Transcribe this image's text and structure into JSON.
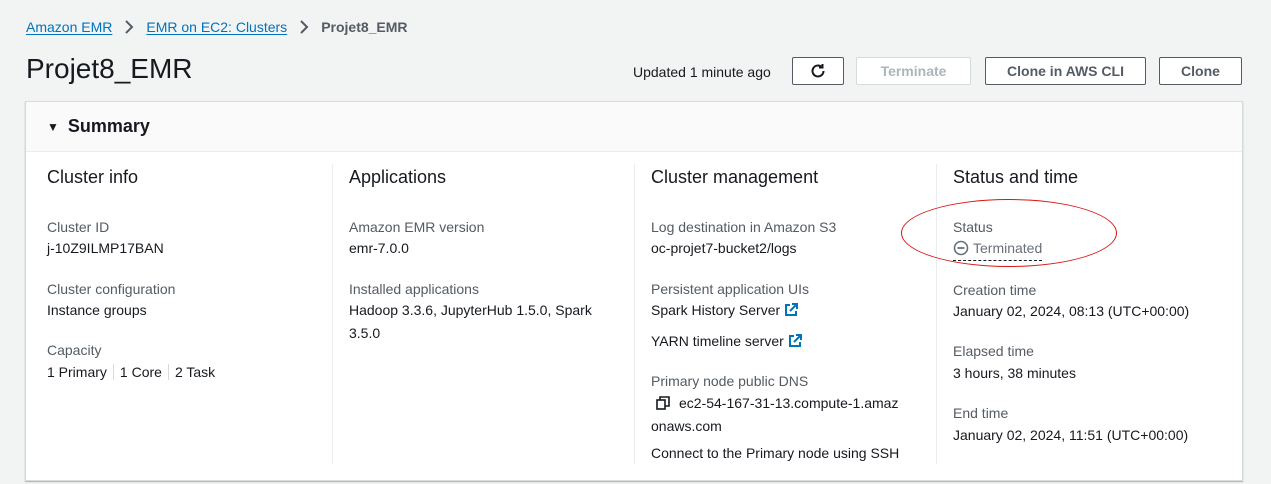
{
  "breadcrumb": {
    "items": [
      "Amazon EMR",
      "EMR on EC2: Clusters"
    ],
    "current": "Projet8_EMR"
  },
  "header": {
    "title": "Projet8_EMR",
    "updated": "Updated 1 minute ago",
    "refresh_icon": "refresh-icon",
    "terminate_label": "Terminate",
    "clone_cli_label": "Clone in AWS CLI",
    "clone_label": "Clone"
  },
  "summary": {
    "title": "Summary",
    "cluster_info": {
      "heading": "Cluster info",
      "cluster_id_label": "Cluster ID",
      "cluster_id": "j-10Z9ILMP17BAN",
      "config_label": "Cluster configuration",
      "config": "Instance groups",
      "capacity_label": "Capacity",
      "capacity": [
        "1 Primary",
        "1 Core",
        "2 Task"
      ]
    },
    "applications": {
      "heading": "Applications",
      "version_label": "Amazon EMR version",
      "version": "emr-7.0.0",
      "installed_label": "Installed applications",
      "installed_line1": "Hadoop 3.3.6, JupyterHub 1.5.0, Spark",
      "installed_line2": "3.5.0"
    },
    "management": {
      "heading": "Cluster management",
      "log_label": "Log destination in Amazon S3",
      "log_link": "oc-projet7-bucket2/logs",
      "ui_label": "Persistent application UIs",
      "spark_link": "Spark History Server",
      "yarn_link": "YARN timeline server",
      "dns_label": "Primary node public DNS",
      "dns_line1": "ec2-54-167-31-13.compute-1.amaz",
      "dns_line2": "onaws.com",
      "ssh_link": "Connect to the Primary node using SSH"
    },
    "status_time": {
      "heading": "Status and time",
      "status_label": "Status",
      "status": "Terminated",
      "creation_label": "Creation time",
      "creation": "January 02, 2024, 08:13 (UTC+00:00)",
      "elapsed_label": "Elapsed time",
      "elapsed": "3 hours, 38 minutes",
      "end_label": "End time",
      "end": "January 02, 2024, 11:51 (UTC+00:00)"
    }
  },
  "colors": {
    "link": "#0073bb",
    "annotation": "#d91515"
  }
}
